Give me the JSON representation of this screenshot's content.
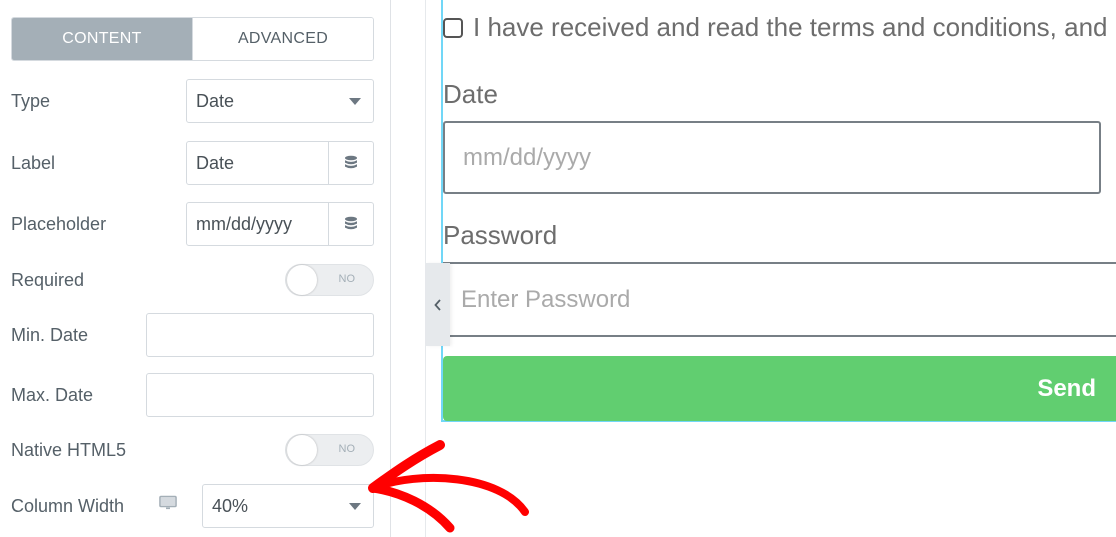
{
  "panel": {
    "tabs": [
      {
        "label": "CONTENT",
        "active": true
      },
      {
        "label": "ADVANCED",
        "active": false
      }
    ],
    "fields": {
      "type": {
        "label": "Type",
        "value": "Date"
      },
      "label": {
        "label": "Label",
        "value": "Date"
      },
      "placeholder": {
        "label": "Placeholder",
        "value": "mm/dd/yyyy"
      },
      "required": {
        "label": "Required",
        "state": "NO"
      },
      "min_date": {
        "label": "Min. Date",
        "value": ""
      },
      "max_date": {
        "label": "Max. Date",
        "value": ""
      },
      "native_html5": {
        "label": "Native HTML5",
        "state": "NO"
      },
      "column_width": {
        "label": "Column Width",
        "value": "40%",
        "device_icon": "desktop-monitor-icon"
      }
    }
  },
  "preview": {
    "terms_text": "I have received and read the terms and conditions, and",
    "date_label": "Date",
    "date_placeholder": "mm/dd/yyyy",
    "password_label": "Password",
    "password_placeholder": "Enter Password",
    "send_label": "Send",
    "colors": {
      "send_button": "#61ce70",
      "selection_outline": "#71d7f7",
      "annotation_arrow": "#ff0000"
    }
  },
  "annotation": {
    "type": "red-arrow",
    "points_to": "column-width-select"
  }
}
